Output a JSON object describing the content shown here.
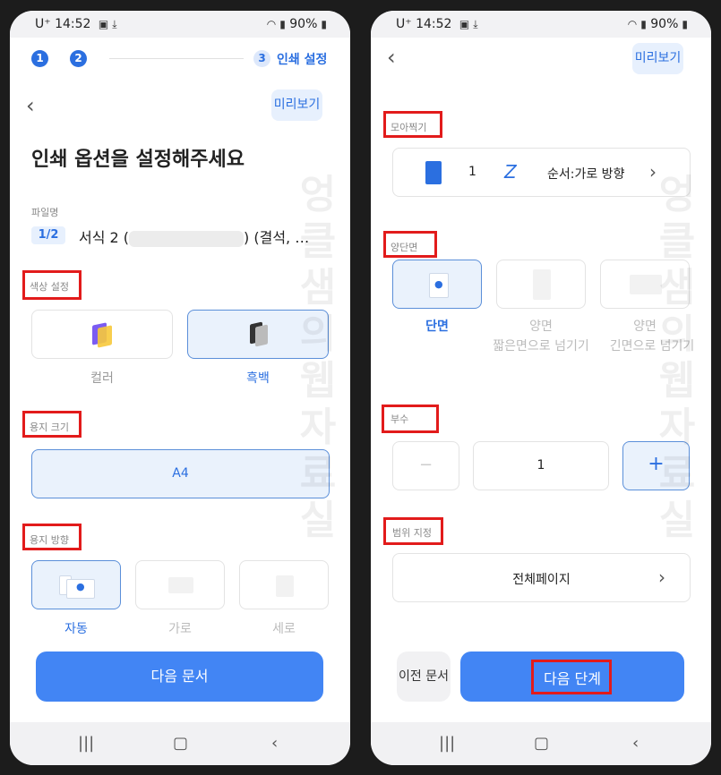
{
  "status": {
    "carrier": "U⁺",
    "time": "14:52",
    "battery": "90%"
  },
  "left": {
    "steps": [
      "1",
      "2",
      "3"
    ],
    "step3_label": "인쇄 설정",
    "preview_label": "미리보기",
    "title": "인쇄 옵션을 설정해주세요",
    "filename_label": "파일명",
    "page_badge": "1/2",
    "filename_start": "서식 2 (",
    "filename_end": ") (결석, …",
    "color_section": "색상 설정",
    "color_options": [
      "컬러",
      "흑백"
    ],
    "paper_size_section": "용지 크기",
    "paper_size_value": "A4",
    "orientation_section": "용지 방향",
    "orientation_options": [
      "자동",
      "가로",
      "세로"
    ],
    "next_doc_label": "다음 문서",
    "watermark": [
      "엉",
      "클",
      "샘",
      "의",
      "웹",
      "자",
      "료",
      "실"
    ]
  },
  "right": {
    "preview_label": "미리보기",
    "nup_section": "모아찍기",
    "nup_count": "1",
    "nup_order": "순서:가로 방향",
    "duplex_section": "양단면",
    "duplex_options": [
      {
        "title": "단면",
        "sub": ""
      },
      {
        "title": "양면",
        "sub": "짧은면으로 넘기기"
      },
      {
        "title": "양면",
        "sub": "긴면으로 넘기기"
      }
    ],
    "copies_section": "부수",
    "copies_minus": "−",
    "copies_value": "1",
    "copies_plus": "+",
    "range_section": "범위 지정",
    "range_value": "전체페이지",
    "prev_doc_label": "이전 문서",
    "next_step_label": "다음 단계",
    "watermark": [
      "엉",
      "클",
      "샘",
      "의",
      "웹",
      "자",
      "료",
      "실"
    ]
  },
  "colors": {
    "accent": "#4285f4",
    "highlight": "#e21b1b",
    "selected_bg": "#eaf2fc"
  },
  "icons": [
    "download-icon",
    "gallery-icon",
    "wifi-icon",
    "signal-icon",
    "battery-icon",
    "back-chevron-icon",
    "chevron-right-icon",
    "z-order-icon",
    "person-icon",
    "recent-apps-icon",
    "home-icon",
    "nav-back-icon"
  ]
}
